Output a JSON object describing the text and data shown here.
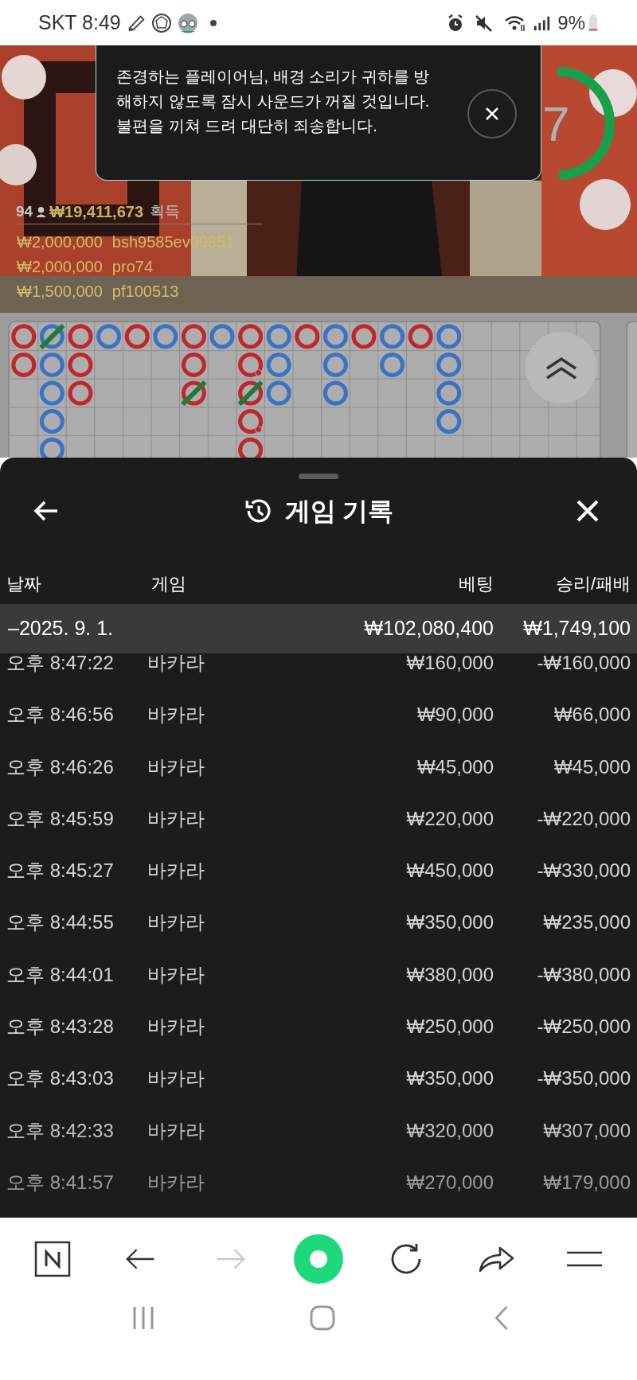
{
  "status_bar": {
    "carrier_time": "SKT 8:49",
    "battery": "9%"
  },
  "video": {
    "timer": "7",
    "player_count": "94",
    "total_won": "₩19,411,673",
    "total_won_label": "획득",
    "top_bets": [
      {
        "amount": "₩2,000,000",
        "player": "bsh9585ev09851"
      },
      {
        "amount": "₩2,000,000",
        "player": "pro74"
      },
      {
        "amount": "₩1,500,000",
        "player": "pf100513"
      }
    ]
  },
  "notice": {
    "message": "존경하는 플레이어님, 배경 소리가 귀하를 방해하지 않도록 잠시 사운드가 꺼질 것입니다. 불편을 끼쳐 드려 대단히 죄송합니다."
  },
  "road": {
    "columns": [
      [
        {
          "color": "#c0272d",
          "tie": false,
          "pair": false
        },
        {
          "color": "#c0272d",
          "tie": false,
          "pair": false
        }
      ],
      [
        {
          "color": "#3a72c4",
          "tie": true,
          "pair": false
        },
        {
          "color": "#3a72c4",
          "tie": false,
          "pair": false
        },
        {
          "color": "#3a72c4",
          "tie": false,
          "pair": false
        },
        {
          "color": "#3a72c4",
          "tie": false,
          "pair": false
        },
        {
          "color": "#3a72c4",
          "tie": false,
          "pair": false
        }
      ],
      [
        {
          "color": "#c0272d",
          "tie": false,
          "pair": false
        },
        {
          "color": "#c0272d",
          "tie": false,
          "pair": false
        },
        {
          "color": "#c0272d",
          "tie": false,
          "pair": false
        }
      ],
      [
        {
          "color": "#3a72c4",
          "tie": false,
          "pair": false
        }
      ],
      [
        {
          "color": "#c0272d",
          "tie": false,
          "pair": false
        }
      ],
      [
        {
          "color": "#3a72c4",
          "tie": false,
          "pair": false
        }
      ],
      [
        {
          "color": "#c0272d",
          "tie": false,
          "pair": false
        },
        {
          "color": "#c0272d",
          "tie": false,
          "pair": false
        },
        {
          "color": "#c0272d",
          "tie": true,
          "pair": false
        }
      ],
      [
        {
          "color": "#3a72c4",
          "tie": false,
          "pair": false
        }
      ],
      [
        {
          "color": "#c0272d",
          "tie": false,
          "pair": false
        },
        {
          "color": "#c0272d",
          "tie": false,
          "pair": true
        },
        {
          "color": "#c0272d",
          "tie": true,
          "pair": false
        },
        {
          "color": "#c0272d",
          "tie": false,
          "pair": true
        },
        {
          "color": "#c0272d",
          "tie": false,
          "pair": false
        }
      ],
      [
        {
          "color": "#3a72c4",
          "tie": false,
          "pair": false
        },
        {
          "color": "#3a72c4",
          "tie": false,
          "pair": false
        },
        {
          "color": "#3a72c4",
          "tie": false,
          "pair": false
        }
      ],
      [
        {
          "color": "#c0272d",
          "tie": false,
          "pair": false
        }
      ],
      [
        {
          "color": "#3a72c4",
          "tie": false,
          "pair": false
        },
        {
          "color": "#3a72c4",
          "tie": false,
          "pair": false
        },
        {
          "color": "#3a72c4",
          "tie": false,
          "pair": false
        }
      ],
      [
        {
          "color": "#c0272d",
          "tie": false,
          "pair": false
        }
      ],
      [
        {
          "color": "#3a72c4",
          "tie": false,
          "pair": false
        },
        {
          "color": "#3a72c4",
          "tie": false,
          "pair": false
        }
      ],
      [
        {
          "color": "#c0272d",
          "tie": false,
          "pair": false
        }
      ],
      [
        {
          "color": "#3a72c4",
          "tie": false,
          "pair": false
        },
        {
          "color": "#3a72c4",
          "tie": false,
          "pair": false
        },
        {
          "color": "#3a72c4",
          "tie": false,
          "pair": false
        },
        {
          "color": "#3a72c4",
          "tie": false,
          "pair": false
        }
      ]
    ]
  },
  "history": {
    "title": "게임 기록",
    "columns": [
      "날짜",
      "게임",
      "베팅",
      "승리/패배"
    ],
    "date_group": {
      "date": "–2025. 9. 1.",
      "bet": "₩102,080,400",
      "result": "₩1,749,100"
    },
    "rows": [
      {
        "time": "오후 8:47:22",
        "game": "바카라",
        "bet": "₩160,000",
        "result": "-₩160,000"
      },
      {
        "time": "오후 8:46:56",
        "game": "바카라",
        "bet": "₩90,000",
        "result": "₩66,000"
      },
      {
        "time": "오후 8:46:26",
        "game": "바카라",
        "bet": "₩45,000",
        "result": "₩45,000"
      },
      {
        "time": "오후 8:45:59",
        "game": "바카라",
        "bet": "₩220,000",
        "result": "-₩220,000"
      },
      {
        "time": "오후 8:45:27",
        "game": "바카라",
        "bet": "₩450,000",
        "result": "-₩330,000"
      },
      {
        "time": "오후 8:44:55",
        "game": "바카라",
        "bet": "₩350,000",
        "result": "₩235,000"
      },
      {
        "time": "오후 8:44:01",
        "game": "바카라",
        "bet": "₩380,000",
        "result": "-₩380,000"
      },
      {
        "time": "오후 8:43:28",
        "game": "바카라",
        "bet": "₩250,000",
        "result": "-₩250,000"
      },
      {
        "time": "오후 8:43:03",
        "game": "바카라",
        "bet": "₩350,000",
        "result": "-₩350,000"
      },
      {
        "time": "오후 8:42:33",
        "game": "바카라",
        "bet": "₩320,000",
        "result": "₩307,000"
      },
      {
        "time": "오후 8:41:57",
        "game": "바카라",
        "bet": "₩270,000",
        "result": "₩179,000"
      }
    ]
  }
}
